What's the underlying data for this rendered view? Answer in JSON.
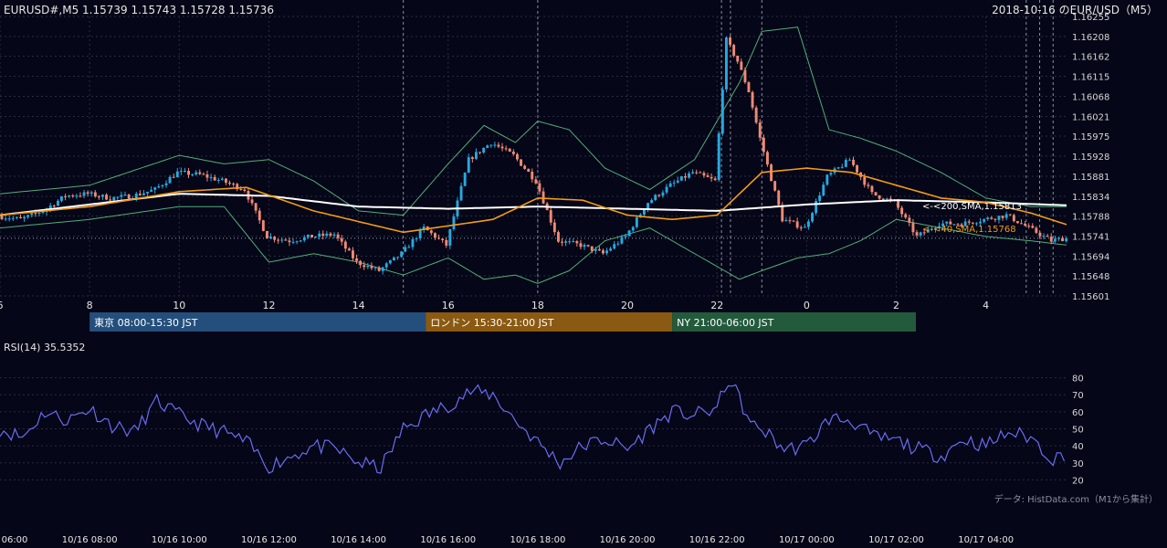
{
  "header": {
    "symbol_line": "EURUSD#,M5 1.15739 1.15743 1.15728 1.15736",
    "title_right": "2018-10-16 のEUR/USD（M5）"
  },
  "colors": {
    "background": "#050617",
    "grid": "#2a2d40",
    "candle_up": "#27a9e1",
    "candle_down": "#f08a74",
    "sma200": "#ffffff",
    "sma40": "#f39c12",
    "bollinger": "#4fae7a",
    "rsi_line": "#6a6cf2",
    "tokyo": "#244f7c",
    "london": "#8a5a12",
    "ny": "#245a3c"
  },
  "chart_data": [
    {
      "type": "candlestick",
      "y_ticks": [
        "1.16255",
        "1.16208",
        "1.16162",
        "1.16115",
        "1.16068",
        "1.16021",
        "1.15975",
        "1.15928",
        "1.15881",
        "1.15834",
        "1.15788",
        "1.15741",
        "1.15694",
        "1.15648",
        "1.15601"
      ],
      "ylim": [
        1.15601,
        1.16255
      ],
      "x_ticks": [
        "6",
        "8",
        "10",
        "12",
        "14",
        "16",
        "18",
        "20",
        "22",
        "0",
        "2",
        "4"
      ],
      "x_tick_hours": [
        6,
        8,
        10,
        12,
        14,
        16,
        18,
        20,
        22,
        24,
        26,
        28
      ],
      "xlim_hours": [
        6,
        29.8
      ],
      "price_hours": [
        6.0,
        6.5,
        7.0,
        7.5,
        8.0,
        8.5,
        9.0,
        9.5,
        10.0,
        10.5,
        11.0,
        11.5,
        12.0,
        12.5,
        13.0,
        13.5,
        14.0,
        14.5,
        15.0,
        15.5,
        16.0,
        16.5,
        17.0,
        17.5,
        18.0,
        18.5,
        19.0,
        19.5,
        20.0,
        20.5,
        21.0,
        21.5,
        22.0,
        22.25,
        22.5,
        22.75,
        23.0,
        23.5,
        24.0,
        24.5,
        25.0,
        25.5,
        26.0,
        26.5,
        27.0,
        27.5,
        28.0,
        28.5,
        29.0,
        29.5,
        29.8
      ],
      "price_path": [
        1.15788,
        1.1578,
        1.158,
        1.15835,
        1.1584,
        1.1583,
        1.15835,
        1.1585,
        1.1589,
        1.15885,
        1.1587,
        1.1585,
        1.1574,
        1.1573,
        1.1574,
        1.15745,
        1.1568,
        1.1566,
        1.157,
        1.1576,
        1.1572,
        1.1592,
        1.1596,
        1.1593,
        1.1587,
        1.1573,
        1.1572,
        1.157,
        1.1574,
        1.1582,
        1.1586,
        1.1589,
        1.1587,
        1.162,
        1.1615,
        1.1608,
        1.1597,
        1.1578,
        1.1576,
        1.1588,
        1.1592,
        1.1584,
        1.1582,
        1.1574,
        1.1577,
        1.1577,
        1.1578,
        1.1579,
        1.1576,
        1.1573,
        1.15736
      ],
      "sma200": {
        "label": "<-<200,SMA,1.15813",
        "value": 1.15813,
        "hours": [
          6,
          8,
          10,
          12,
          14,
          16,
          18,
          20,
          22,
          24,
          26,
          28,
          29.8
        ],
        "values": [
          1.1579,
          1.15815,
          1.1584,
          1.15835,
          1.1581,
          1.15805,
          1.1581,
          1.15805,
          1.158,
          1.15815,
          1.15825,
          1.1582,
          1.15813
        ]
      },
      "sma40": {
        "label": "<-<40,SMA,1.15768",
        "value": 1.15768,
        "hours": [
          6,
          8,
          10,
          11.5,
          13,
          15,
          17,
          18,
          19,
          20,
          21,
          22,
          23,
          24,
          25,
          26,
          27,
          28,
          29,
          29.8
        ],
        "values": [
          1.1579,
          1.1581,
          1.15845,
          1.15855,
          1.158,
          1.1575,
          1.1578,
          1.1583,
          1.15825,
          1.1579,
          1.1578,
          1.1579,
          1.1589,
          1.159,
          1.1589,
          1.1586,
          1.1583,
          1.1582,
          1.15795,
          1.15768
        ]
      },
      "bb_upper": {
        "hours": [
          6,
          8,
          10,
          11,
          12,
          13,
          14,
          15,
          16,
          16.8,
          17.5,
          18,
          18.7,
          19.5,
          20.5,
          21.5,
          22.5,
          23,
          23.8,
          24.5,
          25.2,
          26,
          27,
          28,
          29,
          29.8
        ],
        "values": [
          1.1584,
          1.1586,
          1.1593,
          1.1591,
          1.1592,
          1.1587,
          1.158,
          1.1579,
          1.1591,
          1.16,
          1.1596,
          1.1601,
          1.1599,
          1.159,
          1.1585,
          1.1592,
          1.161,
          1.1622,
          1.1623,
          1.1599,
          1.1597,
          1.1594,
          1.1589,
          1.1583,
          1.1581,
          1.1581
        ]
      },
      "bb_lower": {
        "hours": [
          6,
          8,
          10,
          11,
          12,
          13,
          14,
          15,
          16,
          16.8,
          17.5,
          18,
          18.7,
          19.5,
          20.5,
          21.5,
          22.5,
          23,
          23.8,
          24.5,
          25.2,
          26,
          27,
          28,
          29,
          29.8
        ],
        "values": [
          1.1576,
          1.1578,
          1.1581,
          1.1581,
          1.1568,
          1.157,
          1.1568,
          1.1565,
          1.1569,
          1.1564,
          1.1565,
          1.1563,
          1.1566,
          1.1573,
          1.1576,
          1.157,
          1.1564,
          1.1566,
          1.1569,
          1.157,
          1.1573,
          1.1578,
          1.1576,
          1.1574,
          1.1573,
          1.1572
        ]
      },
      "vertical_markers_hours": [
        15.0,
        18.0,
        22.1,
        22.3,
        23.0,
        28.9,
        29.2,
        29.5
      ]
    },
    {
      "type": "line",
      "label": "RSI(14) 35.5352",
      "y_ticks": [
        "80",
        "70",
        "60",
        "50",
        "40",
        "30",
        "20"
      ],
      "ylim": [
        17,
        83
      ],
      "x_ticks": [
        "10/16 06:00",
        "10/16 08:00",
        "10/16 10:00",
        "10/16 12:00",
        "10/16 14:00",
        "10/16 16:00",
        "10/16 18:00",
        "10/16 20:00",
        "10/16 22:00",
        "10/17 00:00",
        "10/17 02:00",
        "10/17 04:00"
      ],
      "hours": [
        6.0,
        6.5,
        7.0,
        7.5,
        8.0,
        8.5,
        9.0,
        9.5,
        10.0,
        10.5,
        11.0,
        11.5,
        12.0,
        12.5,
        13.0,
        13.5,
        14.0,
        14.5,
        15.0,
        15.5,
        16.0,
        16.5,
        17.0,
        17.5,
        18.0,
        18.5,
        19.0,
        19.5,
        20.0,
        20.5,
        21.0,
        21.5,
        22.0,
        22.25,
        22.5,
        22.75,
        23.0,
        23.5,
        24.0,
        24.5,
        25.0,
        25.5,
        26.0,
        26.5,
        27.0,
        27.5,
        28.0,
        28.5,
        29.0,
        29.5,
        29.8
      ],
      "values": [
        50,
        45,
        60,
        55,
        62,
        52,
        48,
        66,
        58,
        52,
        48,
        42,
        28,
        34,
        40,
        38,
        30,
        27,
        50,
        58,
        64,
        72,
        70,
        55,
        42,
        30,
        40,
        44,
        38,
        50,
        60,
        58,
        62,
        79,
        68,
        52,
        50,
        38,
        40,
        56,
        55,
        45,
        43,
        38,
        34,
        44,
        40,
        48,
        45,
        32,
        36
      ]
    }
  ],
  "sessions": [
    {
      "label": "東京 08:00-15:30 JST"
    },
    {
      "label": "ロンドン 15:30-21:00 JST"
    },
    {
      "label": "NY 21:00-06:00 JST"
    }
  ],
  "footer": {
    "credit": "データ: HistData.com（M1から集計）"
  }
}
